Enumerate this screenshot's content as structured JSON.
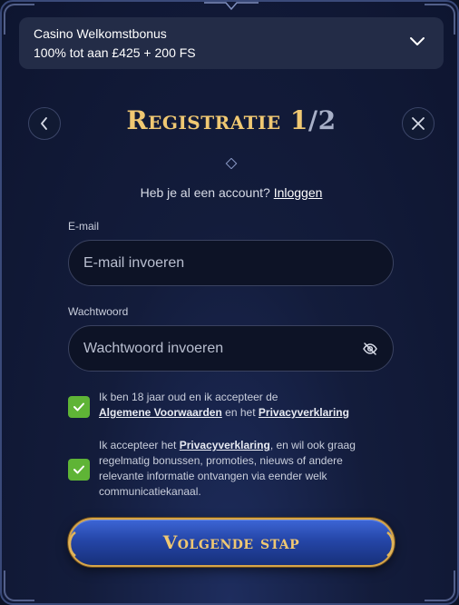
{
  "bonus": {
    "title": "Casino Welkomstbonus",
    "amount": "100% tot aan £425 + 200 FS"
  },
  "header": {
    "title_main": "Registratie 1",
    "title_sep": "/",
    "title_total": "2"
  },
  "login_prompt": {
    "text": "Heb je al een account?",
    "link": "Inloggen"
  },
  "email": {
    "label": "E-mail",
    "placeholder": "E-mail invoeren",
    "value": ""
  },
  "password": {
    "label": "Wachtwoord",
    "placeholder": "Wachtwoord invoeren",
    "value": ""
  },
  "consent_age": {
    "checked": true,
    "text_before": "Ik ben 18 jaar oud en ik accepteer de",
    "link_terms": "Algemene Voorwaarden",
    "text_mid": "en het",
    "link_privacy": "Privacyverklaring"
  },
  "consent_marketing": {
    "checked": true,
    "text_before": "Ik accepteer het",
    "link_privacy": "Privacyverklaring",
    "text_after": ", en wil ook graag regelmatig bonussen, promoties, nieuws of andere relevante informatie ontvangen via eender welk communicatiekanaal."
  },
  "next_button": {
    "label": "Volgende stap"
  },
  "colors": {
    "gold": "#f0c872",
    "check_green": "#5fb436",
    "panel_bg": "#131c3b"
  }
}
